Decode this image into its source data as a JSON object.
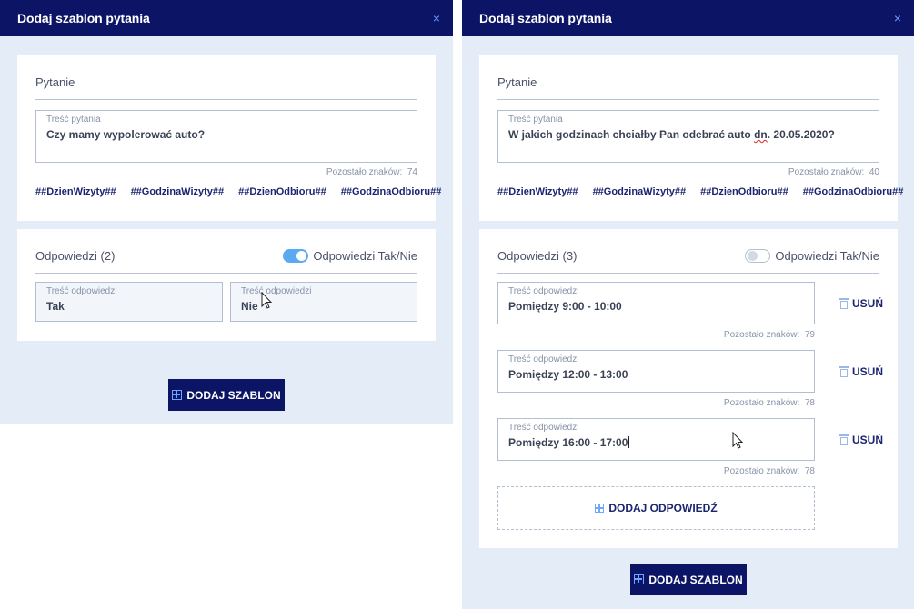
{
  "left": {
    "header": {
      "title": "Dodaj szablon pytania",
      "close": "×"
    },
    "question": {
      "section_title": "Pytanie",
      "field_label": "Treść pytania",
      "value": "Czy mamy wypolerować auto?",
      "remaining_label": "Pozostało znaków:",
      "remaining_count": "74",
      "tags": [
        "##DzienWizyty##",
        "##GodzinaWizyty##",
        "##DzienOdbioru##",
        "##GodzinaOdbioru##"
      ]
    },
    "answers": {
      "section_title": "Odpowiedzi (2)",
      "toggle_label": "Odpowiedzi Tak/Nie",
      "toggle_on": true,
      "items": [
        {
          "label": "Treść odpowiedzi",
          "value": "Tak"
        },
        {
          "label": "Treść odpowiedzi",
          "value": "Nie"
        }
      ]
    },
    "submit_label": "DODAJ SZABLON"
  },
  "right": {
    "header": {
      "title": "Dodaj szablon pytania",
      "close": "×"
    },
    "question": {
      "section_title": "Pytanie",
      "field_label": "Treść pytania",
      "value_before": "W jakich godzinach chciałby Pan odebrać auto ",
      "value_misspelled": "dn",
      "value_after": ". 20.05.2020?",
      "remaining_label": "Pozostało znaków:",
      "remaining_count": "40",
      "tags": [
        "##DzienWizyty##",
        "##GodzinaWizyty##",
        "##DzienOdbioru##",
        "##GodzinaOdbioru##"
      ]
    },
    "answers": {
      "section_title": "Odpowiedzi (3)",
      "toggle_label": "Odpowiedzi Tak/Nie",
      "toggle_on": false,
      "remove_label": "USUŃ",
      "remaining_label": "Pozostało znaków:",
      "items": [
        {
          "label": "Treść odpowiedzi",
          "value": "Pomiędzy 9:00 - 10:00",
          "remaining": "79"
        },
        {
          "label": "Treść odpowiedzi",
          "value": "Pomiędzy 12:00 - 13:00",
          "remaining": "78"
        },
        {
          "label": "Treść odpowiedzi",
          "value": "Pomiędzy 16:00 - 17:00",
          "remaining": "78"
        }
      ],
      "add_answer_label": "DODAJ ODPOWIEDŹ"
    },
    "submit_label": "DODAJ SZABLON"
  },
  "colors": {
    "header": "#0c1466",
    "panel_bg": "#e3ecf7",
    "accent": "#5aaaf2",
    "tag_text": "#1b2470"
  },
  "icons": [
    "close-icon",
    "plus-square-icon",
    "trash-icon",
    "mouse-pointer-icon",
    "toggle-switch"
  ]
}
